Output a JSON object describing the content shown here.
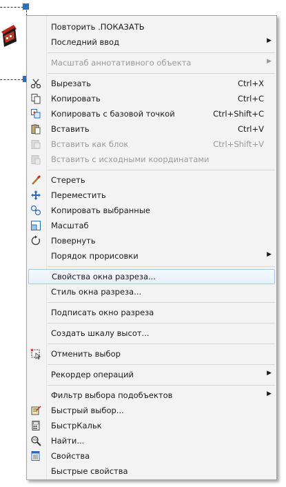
{
  "menu": {
    "items": [
      {
        "label": "Повторить .ПОКАЗАТЬ",
        "shortcut": "",
        "submenu": false,
        "disabled": false,
        "icon": ""
      },
      {
        "label": "Последний ввод",
        "shortcut": "",
        "submenu": true,
        "disabled": false,
        "icon": ""
      },
      {
        "label": "Масштаб аннотативного объекта",
        "shortcut": "",
        "submenu": true,
        "disabled": true,
        "icon": ""
      },
      {
        "label": "Вырезать",
        "shortcut": "Ctrl+X",
        "submenu": false,
        "disabled": false,
        "icon": "scissors-icon"
      },
      {
        "label": "Копировать",
        "shortcut": "Ctrl+C",
        "submenu": false,
        "disabled": false,
        "icon": "copy-icon"
      },
      {
        "label": "Копировать с базовой точкой",
        "shortcut": "Ctrl+Shift+C",
        "submenu": false,
        "disabled": false,
        "icon": "copy-base-icon"
      },
      {
        "label": "Вставить",
        "shortcut": "Ctrl+V",
        "submenu": false,
        "disabled": false,
        "icon": "paste-icon"
      },
      {
        "label": "Вставить как блок",
        "shortcut": "Ctrl+Shift+V",
        "submenu": false,
        "disabled": true,
        "icon": "paste-block-icon"
      },
      {
        "label": "Вставить с исходными координатами",
        "shortcut": "",
        "submenu": false,
        "disabled": true,
        "icon": "paste-coords-icon"
      },
      {
        "label": "Стереть",
        "shortcut": "",
        "submenu": false,
        "disabled": false,
        "icon": "eraser-icon"
      },
      {
        "label": "Переместить",
        "shortcut": "",
        "submenu": false,
        "disabled": false,
        "icon": "move-icon"
      },
      {
        "label": "Копировать выбранные",
        "shortcut": "",
        "submenu": false,
        "disabled": false,
        "icon": "copy-selected-icon"
      },
      {
        "label": "Масштаб",
        "shortcut": "",
        "submenu": false,
        "disabled": false,
        "icon": "scale-icon"
      },
      {
        "label": "Повернуть",
        "shortcut": "",
        "submenu": false,
        "disabled": false,
        "icon": "rotate-icon"
      },
      {
        "label": "Порядок прорисовки",
        "shortcut": "",
        "submenu": true,
        "disabled": false,
        "icon": ""
      },
      {
        "label": "Свойства окна разреза...",
        "shortcut": "",
        "submenu": false,
        "disabled": false,
        "icon": "",
        "highlight": true
      },
      {
        "label": "Стиль окна разреза...",
        "shortcut": "",
        "submenu": false,
        "disabled": false,
        "icon": ""
      },
      {
        "label": "Подписать окно разреза",
        "shortcut": "",
        "submenu": false,
        "disabled": false,
        "icon": ""
      },
      {
        "label": "Создать шкалу высот...",
        "shortcut": "",
        "submenu": false,
        "disabled": false,
        "icon": ""
      },
      {
        "label": "Отменить выбор",
        "shortcut": "",
        "submenu": false,
        "disabled": false,
        "icon": "deselect-icon"
      },
      {
        "label": "Рекордер операций",
        "shortcut": "",
        "submenu": true,
        "disabled": false,
        "icon": ""
      },
      {
        "label": "Фильтр выбора подобъектов",
        "shortcut": "",
        "submenu": true,
        "disabled": false,
        "icon": ""
      },
      {
        "label": "Быстрый выбор...",
        "shortcut": "",
        "submenu": false,
        "disabled": false,
        "icon": "quick-select-icon"
      },
      {
        "label": "БыстрКальк",
        "shortcut": "",
        "submenu": false,
        "disabled": false,
        "icon": "calculator-icon"
      },
      {
        "label": "Найти...",
        "shortcut": "",
        "submenu": false,
        "disabled": false,
        "icon": "find-icon"
      },
      {
        "label": "Свойства",
        "shortcut": "",
        "submenu": false,
        "disabled": false,
        "icon": "properties-icon"
      },
      {
        "label": "Быстрые свойства",
        "shortcut": "",
        "submenu": false,
        "disabled": false,
        "icon": ""
      }
    ]
  }
}
